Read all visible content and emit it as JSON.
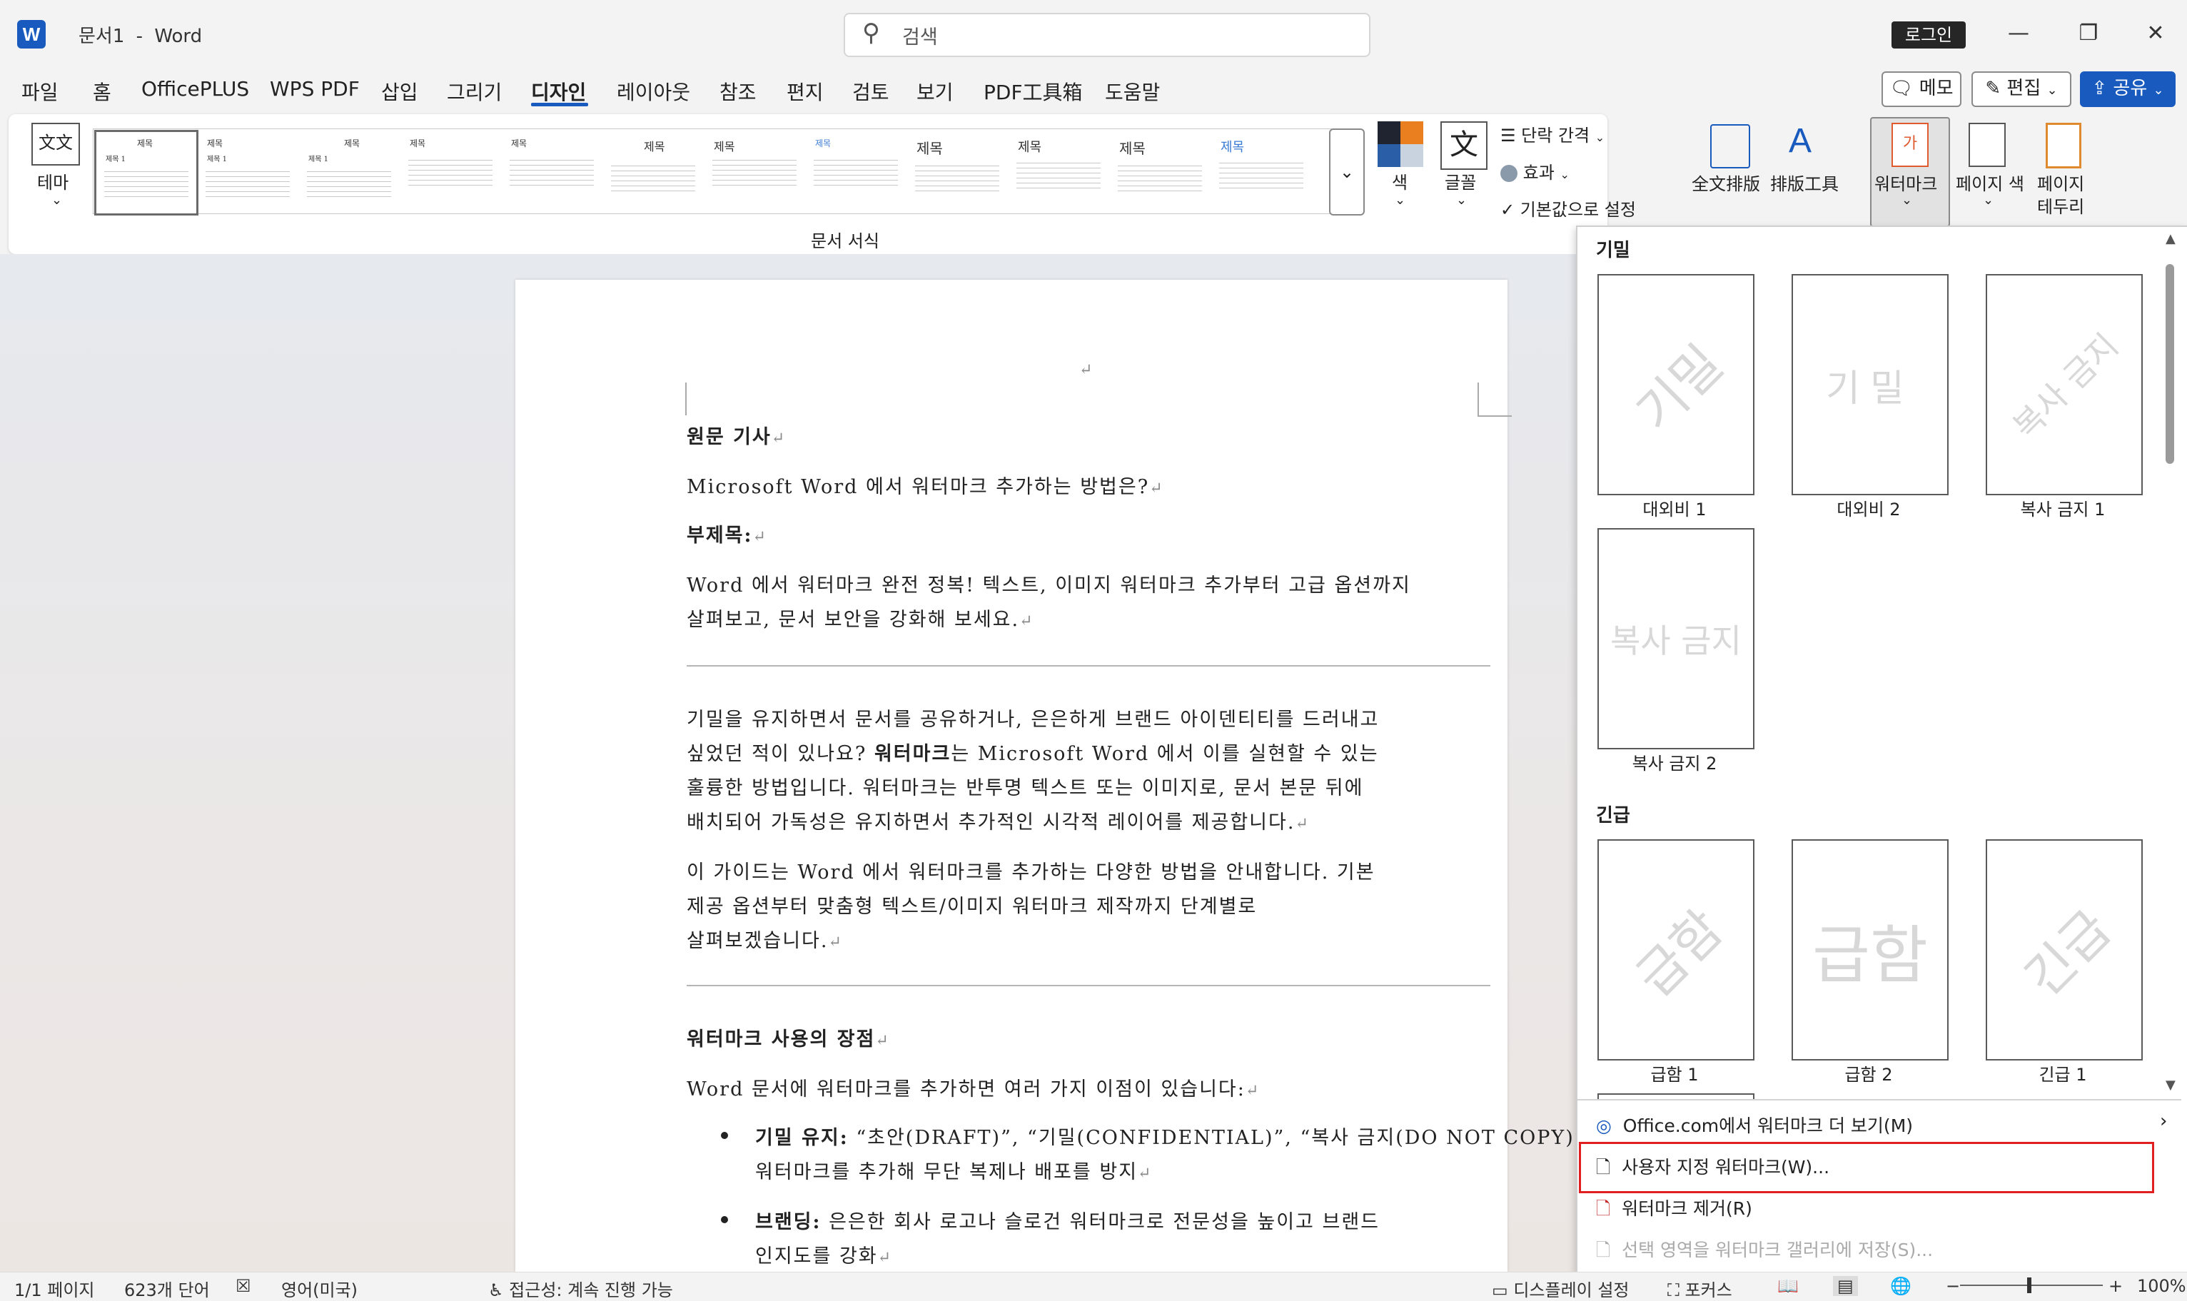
{
  "titlebar": {
    "app_icon": "W",
    "doc_name": "문서1",
    "separator": "-",
    "app_name": "Word",
    "search_placeholder": "검색",
    "login": "로그인",
    "minimize_icon": "—",
    "restore_icon": "❐",
    "close_icon": "✕"
  },
  "menu": {
    "tabs": [
      "파일",
      "홈",
      "OfficePLUS",
      "WPS PDF",
      "삽입",
      "그리기",
      "디자인",
      "레이아웃",
      "참조",
      "편지",
      "검토",
      "보기",
      "PDF工具箱",
      "도움말"
    ],
    "active_tab": "디자인",
    "memo": "메모",
    "edit": "편집",
    "share": "공유"
  },
  "ribbon": {
    "theme_label": "테마",
    "theme_glyph": "文文",
    "gallery_group_label": "문서 서식",
    "gallery_titles": [
      "제목",
      "제목",
      "제목",
      "제목",
      "제목",
      "제목",
      "제목",
      "제목",
      "제목",
      "제목",
      "제목",
      "제목"
    ],
    "gallery_subtitles": [
      "제목 1",
      "제목 1",
      "제목 1",
      "",
      "",
      "",
      "",
      "",
      "",
      "",
      "",
      ""
    ],
    "color_label": "색",
    "font_label": "글꼴",
    "font_glyph": "文",
    "para_spacing": "단락 간격",
    "effects": "효과",
    "set_default": "기본값으로 설정",
    "full_layout": "全文排版",
    "layout_tool": "排版工具",
    "watermark": "워터마크",
    "page_color": "페이지 색",
    "page_border_1": "페이지",
    "page_border_2": "테두리",
    "colors": {
      "accent": "#185abd",
      "ribbon_bg": "#ffffff",
      "highlight_red": "#e02020"
    }
  },
  "document": {
    "para_mark": "↵",
    "heading_orig": "원문 기사",
    "title_line": "Microsoft Word 에서 워터마크 추가하는 방법은?",
    "subtitle_label": "부제목:",
    "sub1": "Word 에서 워터마크 완전 정복! 텍스트, 이미지 워터마크 추가부터 고급 옵션까지",
    "sub2": "살펴보고, 문서 보안을 강화해 보세요.",
    "p1_1": "기밀을 유지하면서 문서를 공유하거나, 은은하게 브랜드 아이덴티티를 드러내고",
    "p1_2a": "싶었던 적이 있나요? ",
    "p1_2b": "워터마크",
    "p1_2c": "는 Microsoft Word 에서 이를 실현할 수 있는",
    "p1_3": "훌륭한 방법입니다. 워터마크는 반투명 텍스트 또는 이미지로, 문서 본문 뒤에",
    "p1_4": "배치되어 가독성은 유지하면서 추가적인 시각적 레이어를 제공합니다.",
    "p2_1": "이 가이드는 Word 에서 워터마크를 추가하는 다양한 방법을 안내합니다. 기본",
    "p2_2": "제공 옵션부터 맞춤형 텍스트/이미지 워터마크 제작까지 단계별로",
    "p2_3": "살펴보겠습니다.",
    "h2": "워터마크 사용의 장점",
    "p3": "Word 문서에 워터마크를 추가하면 여러 가지 이점이 있습니다:",
    "b1_bold": "기밀 유지:",
    "b1_rest": " “초안(DRAFT)”, “기밀(CONFIDENTIAL)”, “복사 금지(DO NOT COPY)”",
    "b1_2": "워터마크를 추가해 무단 복제나 배포를 방지",
    "b2_bold": "브랜딩:",
    "b2_rest": " 은은한 회사 로고나 슬로건 워터마크로 전문성을 높이고 브랜드",
    "b2_2": "인지도를 강화"
  },
  "watermark_panel": {
    "section_confidential": "기밀",
    "section_urgent": "긴급",
    "items_confidential": [
      {
        "caption": "대외비 1",
        "text": "기밀"
      },
      {
        "caption": "대외비 2",
        "text": "기밀"
      },
      {
        "caption": "복사 금지 1",
        "text": "복사 금지"
      },
      {
        "caption": "복사 금지 2",
        "text": "복사 금지"
      }
    ],
    "items_urgent": [
      {
        "caption": "급함 1",
        "text": "급함"
      },
      {
        "caption": "급함 2",
        "text": "급함"
      },
      {
        "caption": "긴급 1",
        "text": "긴급"
      }
    ],
    "more_online": "Office.com에서 워터마크 더 보기(M)",
    "custom": "사용자 지정 워터마크(W)...",
    "remove": "워터마크 제거(R)",
    "save_selection": "선택 영역을 워터마크 갤러리에 저장(S)..."
  },
  "statusbar": {
    "page": "1/1 페이지",
    "words": "623개 단어",
    "language": "영어(미국)",
    "accessibility": "접근성: 계속 진행 가능",
    "display_settings": "디스플레이 설정",
    "focus": "포커스",
    "zoom": "100%"
  }
}
